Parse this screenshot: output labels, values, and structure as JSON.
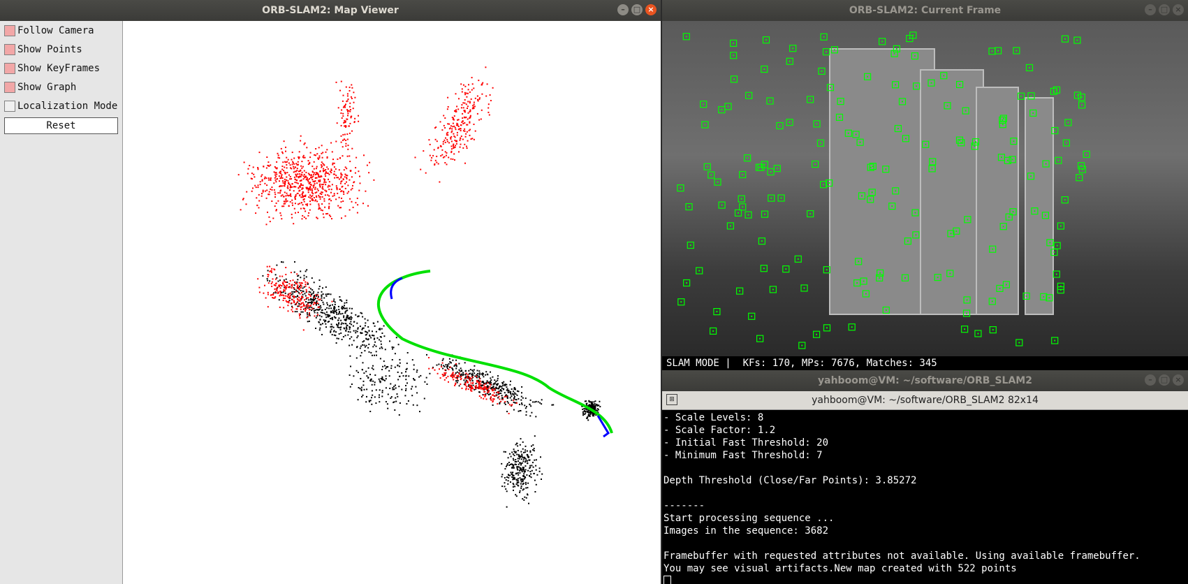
{
  "map_viewer": {
    "title": "ORB-SLAM2: Map Viewer",
    "options": [
      {
        "label": "Follow Camera",
        "checked": true
      },
      {
        "label": "Show Points",
        "checked": true
      },
      {
        "label": "Show KeyFrames",
        "checked": true
      },
      {
        "label": "Show Graph",
        "checked": true
      },
      {
        "label": "Localization Mode",
        "checked": false
      }
    ],
    "reset_label": "Reset",
    "colors": {
      "map_point": "#000000",
      "local_point": "#ff0000",
      "graph": "#00e000",
      "keyframe": "#0000ff"
    }
  },
  "current_frame": {
    "title": "ORB-SLAM2: Current Frame",
    "status": "SLAM MODE |  KFs: 170, MPs: 7676, Matches: 345",
    "feature_color": "#00ff00"
  },
  "terminal": {
    "title": "yahboom@VM: ~/software/ORB_SLAM2",
    "tab_title": "yahboom@VM: ~/software/ORB_SLAM2 82x14",
    "lines": [
      "- Scale Levels: 8",
      "- Scale Factor: 1.2",
      "- Initial Fast Threshold: 20",
      "- Minimum Fast Threshold: 7",
      "",
      "Depth Threshold (Close/Far Points): 3.85272",
      "",
      "-------",
      "Start processing sequence ...",
      "Images in the sequence: 3682",
      "",
      "Framebuffer with requested attributes not available. Using available framebuffer.",
      "You may see visual artifacts.New map created with 522 points"
    ]
  },
  "window_buttons": {
    "minimize": "–",
    "maximize": "□",
    "close": "×"
  }
}
